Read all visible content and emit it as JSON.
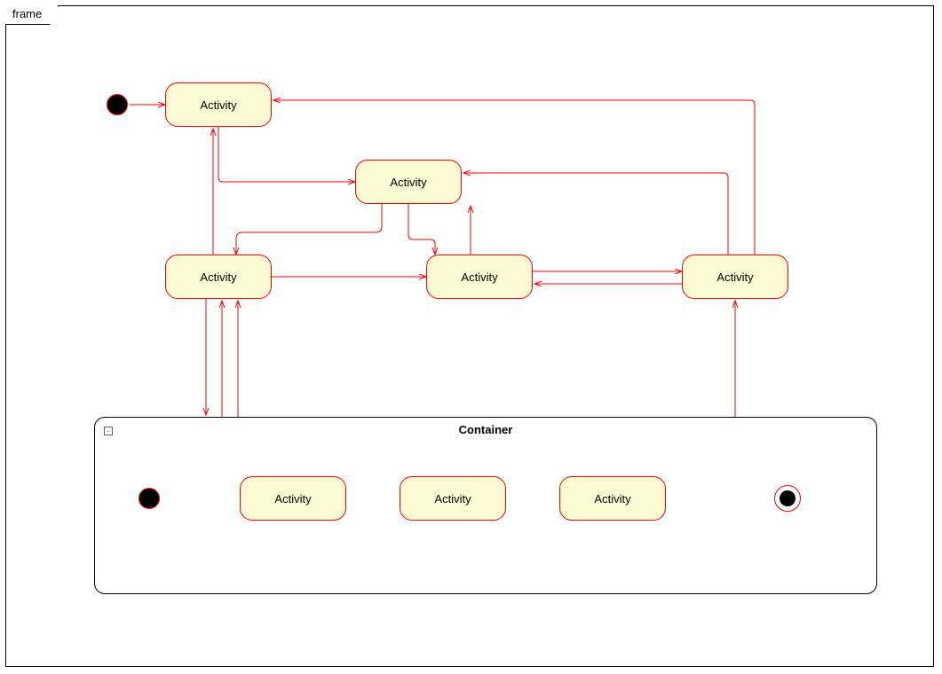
{
  "frame": {
    "label": "frame"
  },
  "container": {
    "title": "Container"
  },
  "nodes": {
    "top": {
      "label": "Activity"
    },
    "mid_upper": {
      "label": "Activity"
    },
    "left": {
      "label": "Activity"
    },
    "center": {
      "label": "Activity"
    },
    "right": {
      "label": "Activity"
    },
    "c1": {
      "label": "Activity"
    },
    "c2": {
      "label": "Activity"
    },
    "c3": {
      "label": "Activity"
    }
  },
  "style": {
    "edge_color": "#ff0000",
    "node_fill": "#FCFAD2"
  },
  "edges_description": [
    "initial -> top",
    "top -> mid_upper",
    "mid_upper -> center",
    "mid_upper -> left (curved)",
    "left -> top (up)",
    "left -> center",
    "center -> right",
    "right -> center",
    "right -> top (long back edge)",
    "center -> mid_upper (up)",
    "right -> mid_upper (up+left corner)",
    "left <-> container (multiple)",
    "container -> right (up)",
    "inner: initial -> c1 -> c2 -> c3 -> final"
  ]
}
